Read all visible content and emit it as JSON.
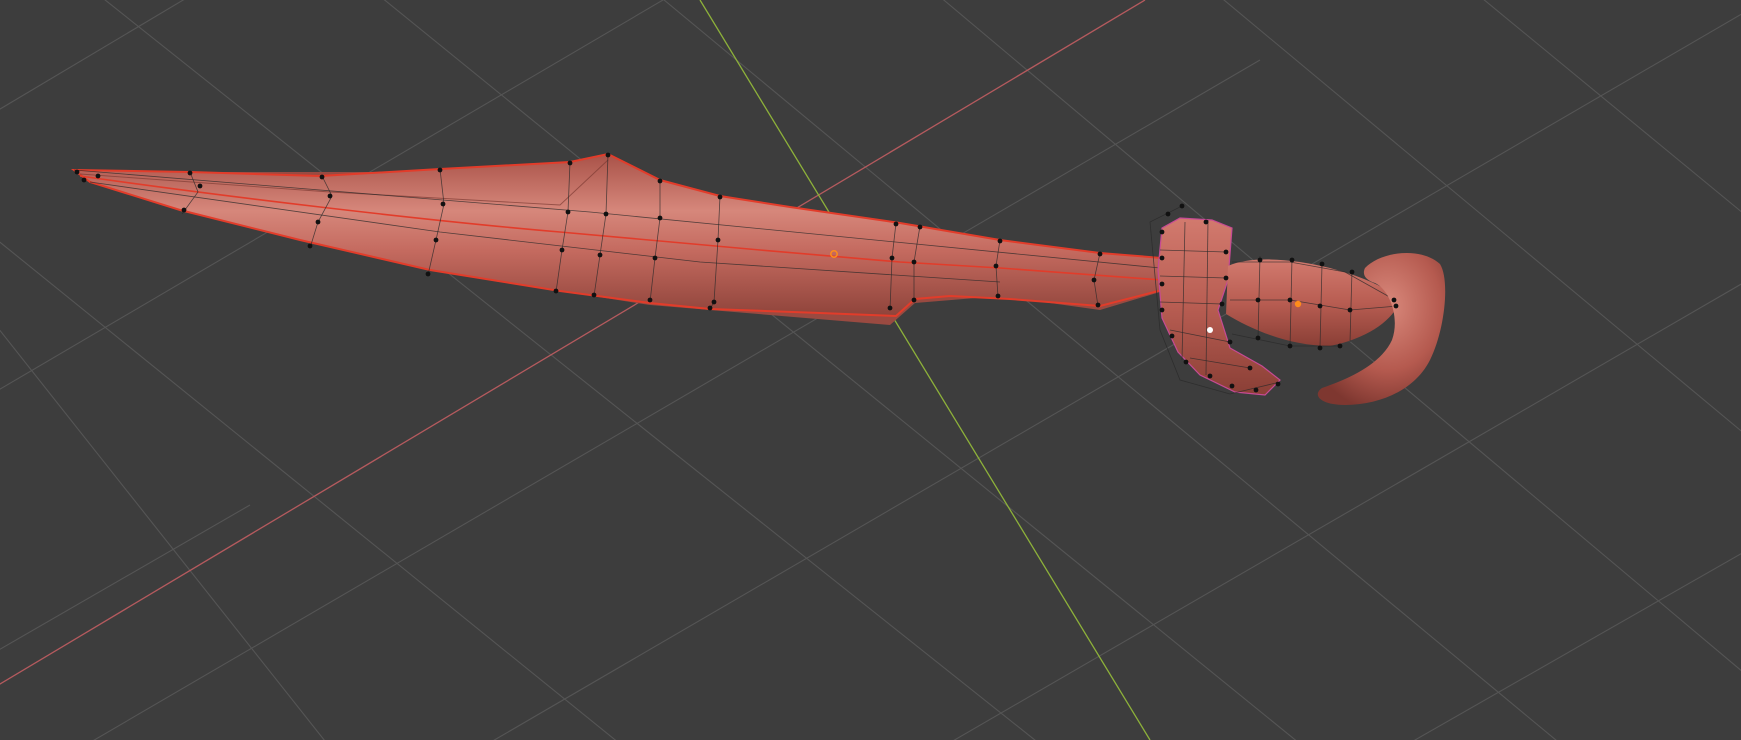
{
  "viewport": {
    "background": "#3d3d3d",
    "grid_color": "#555555",
    "x_axis_color": "#b55a5e",
    "y_axis_color": "#8db13a"
  },
  "object": {
    "name_icon": "sword-mesh",
    "body_color": "#c4675c",
    "body_shade": "#9e4e45",
    "selection_outline": "#e23c2a",
    "active_edge": "#e040ff",
    "origin_marker": "#ff8c1a"
  }
}
